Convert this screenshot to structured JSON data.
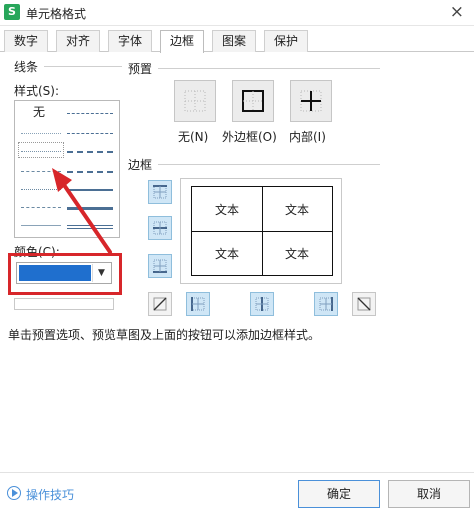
{
  "window": {
    "title": "单元格格式",
    "app_icon": "S",
    "close": "×"
  },
  "tabs": [
    {
      "label": "数字"
    },
    {
      "label": "对齐"
    },
    {
      "label": "字体"
    },
    {
      "label": "边框"
    },
    {
      "label": "图案"
    },
    {
      "label": "保护"
    }
  ],
  "active_tab": "边框",
  "line_section": {
    "title": "线条",
    "style_label": "样式(S):",
    "none_label": "无",
    "color_label": "颜色(C):",
    "selected_color": "#1f6fce"
  },
  "preset_section": {
    "title": "预置",
    "buttons": [
      {
        "label": "无(N)"
      },
      {
        "label": "外边框(O)"
      },
      {
        "label": "内部(I)"
      }
    ]
  },
  "border_section": {
    "title": "边框",
    "preview_cells": [
      "文本",
      "文本",
      "文本",
      "文本"
    ]
  },
  "info_text": "单击预置选项、预览草图及上面的按钮可以添加边框样式。",
  "footer": {
    "tips_label": "操作技巧",
    "ok_label": "确定",
    "cancel_label": "取消"
  },
  "colors": {
    "accent": "#4a90d9",
    "highlight": "#d7262a",
    "app_icon": "#27a65a"
  }
}
